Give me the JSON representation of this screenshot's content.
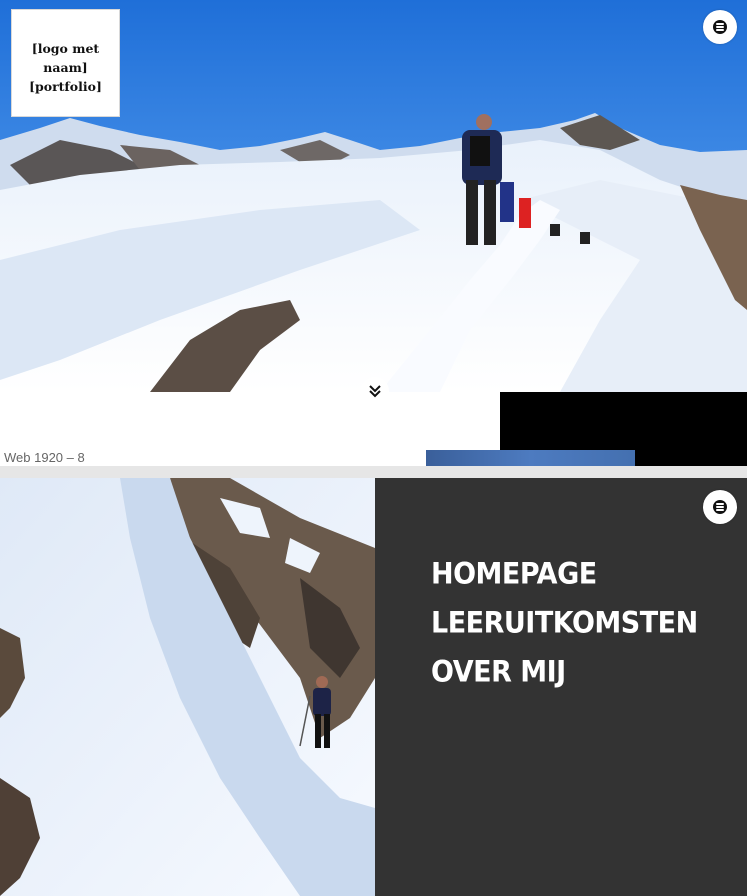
{
  "frame_top": {
    "logo_text": "[logo met naam] [portfolio]",
    "menu_icon": "hamburger-menu-icon",
    "scroll_icon": "double-chevron-down-icon"
  },
  "artboard_label": "Web 1920 – 8",
  "frame_bottom": {
    "menu_icon": "hamburger-menu-icon",
    "nav_items": [
      {
        "label": "HOMEPAGE"
      },
      {
        "label": "LEERUITKOMSTEN"
      },
      {
        "label": "OVER MIJ"
      }
    ]
  },
  "colors": {
    "sky": "#2c7fe0",
    "snow": "#f4f8fd",
    "dark_panel": "#333333",
    "black_block": "#000000"
  }
}
